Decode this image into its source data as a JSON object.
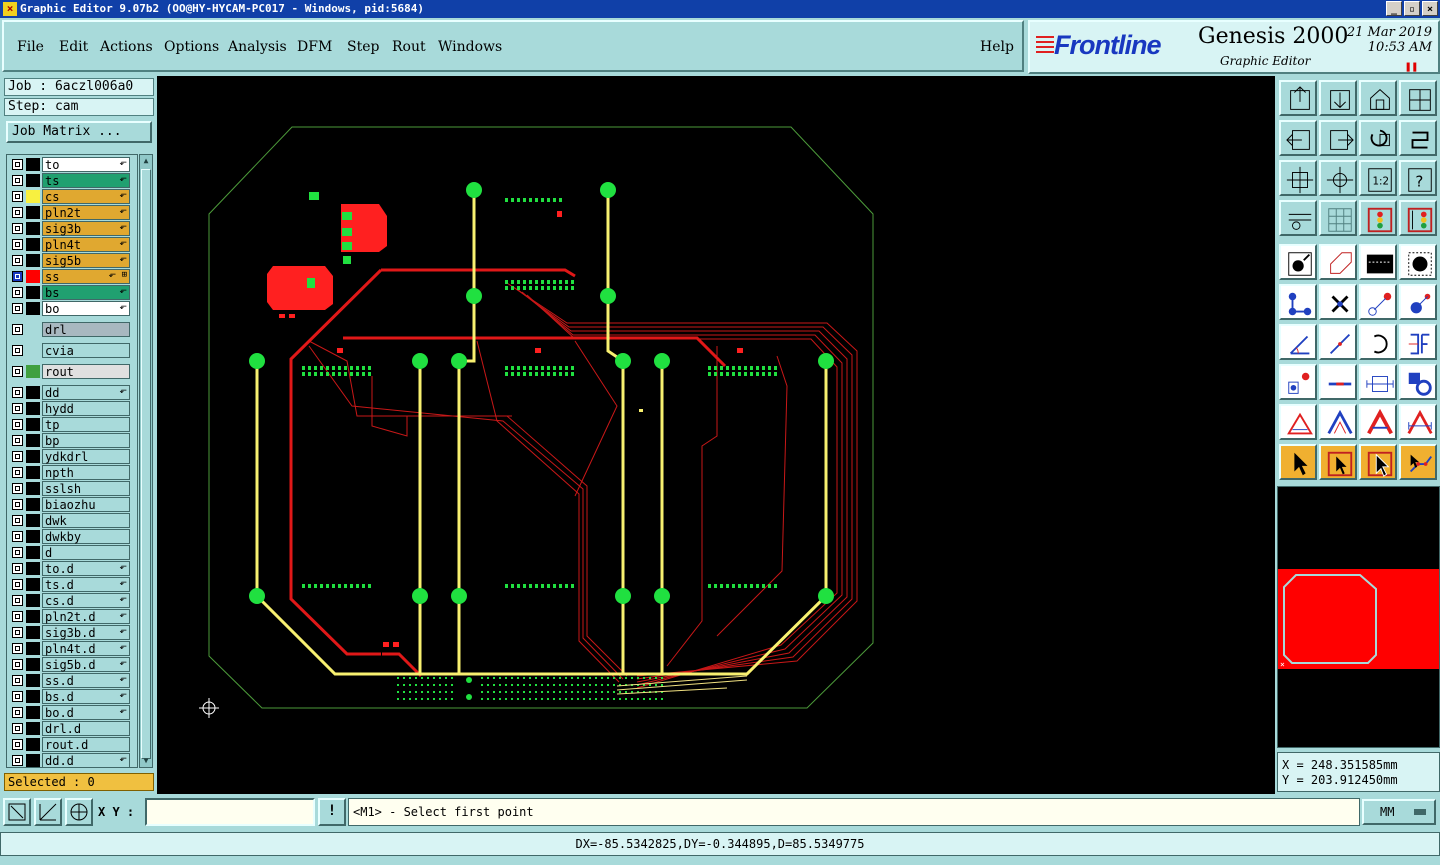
{
  "window": {
    "title": "Graphic Editor 9.07b2 (OO@HY-HYCAM-PC017 - Windows, pid:5684)",
    "controls": [
      "_",
      "▫",
      "×"
    ]
  },
  "menu": {
    "items": [
      "File",
      "Edit",
      "Actions",
      "Options",
      "Analysis",
      "DFM",
      "Step",
      "Rout",
      "Windows"
    ],
    "help": "Help"
  },
  "brand": {
    "logo_text": "Frontline",
    "product": "Genesis 2000",
    "subtitle": "Graphic Editor",
    "date": "21 Mar 2019",
    "time": "10:53 AM",
    "pause_icon": "pause-icon"
  },
  "job": {
    "job_line": "Job : 6aczl006a0",
    "step_line": "Step: cam",
    "matrix_button": "Job Matrix ..."
  },
  "layers": [
    {
      "name": "to",
      "bg": "#ffffff",
      "swatch": "#000000",
      "checked": false,
      "mark": "⬐"
    },
    {
      "name": "ts",
      "bg": "#20a070",
      "swatch": "#000000",
      "checked": false,
      "mark": "⬐"
    },
    {
      "name": "cs",
      "bg": "#e0a830",
      "swatch": "#f8f040",
      "checked": false,
      "mark": "⬐"
    },
    {
      "name": "pln2t",
      "bg": "#e0a830",
      "swatch": "#000000",
      "checked": false,
      "mark": "⬐"
    },
    {
      "name": "sig3b",
      "bg": "#e0a830",
      "swatch": "#000000",
      "checked": false,
      "mark": "⬐"
    },
    {
      "name": "pln4t",
      "bg": "#e0a830",
      "swatch": "#000000",
      "checked": false,
      "mark": "⬐"
    },
    {
      "name": "sig5b",
      "bg": "#e0a830",
      "swatch": "#000000",
      "checked": false,
      "mark": "⬐"
    },
    {
      "name": "ss",
      "bg": "#e0a830",
      "swatch": "#ff0000",
      "checked": true,
      "mark": "⬐ ⊞"
    },
    {
      "name": "bs",
      "bg": "#20a070",
      "swatch": "#000000",
      "checked": false,
      "mark": "⬐"
    },
    {
      "name": "bo",
      "bg": "#ffffff",
      "swatch": "#000000",
      "checked": false,
      "mark": "⬐"
    },
    {
      "name": "drl",
      "bg": "#a8b8c0",
      "swatch": "#a8dada",
      "checked": false,
      "mark": "",
      "gap": true
    },
    {
      "name": "cvia",
      "bg": "#a8dada",
      "swatch": "#a8dada",
      "checked": false,
      "mark": "",
      "gap": true
    },
    {
      "name": "rout",
      "bg": "#e0e0e0",
      "swatch": "#40a040",
      "checked": false,
      "mark": "",
      "gap": true
    },
    {
      "name": "dd",
      "bg": "#a8dada",
      "swatch": "#000000",
      "checked": false,
      "mark": "⬐",
      "gap": true
    },
    {
      "name": "hydd",
      "bg": "#a8dada",
      "swatch": "#000000",
      "checked": false,
      "mark": ""
    },
    {
      "name": "tp",
      "bg": "#a8dada",
      "swatch": "#000000",
      "checked": false,
      "mark": ""
    },
    {
      "name": "bp",
      "bg": "#a8dada",
      "swatch": "#000000",
      "checked": false,
      "mark": ""
    },
    {
      "name": "ydkdrl",
      "bg": "#a8dada",
      "swatch": "#000000",
      "checked": false,
      "mark": ""
    },
    {
      "name": "npth",
      "bg": "#a8dada",
      "swatch": "#000000",
      "checked": false,
      "mark": ""
    },
    {
      "name": "sslsh",
      "bg": "#a8dada",
      "swatch": "#000000",
      "checked": false,
      "mark": ""
    },
    {
      "name": "biaozhu",
      "bg": "#a8dada",
      "swatch": "#000000",
      "checked": false,
      "mark": ""
    },
    {
      "name": "dwk",
      "bg": "#a8dada",
      "swatch": "#000000",
      "checked": false,
      "mark": ""
    },
    {
      "name": "dwkby",
      "bg": "#a8dada",
      "swatch": "#000000",
      "checked": false,
      "mark": ""
    },
    {
      "name": "d",
      "bg": "#a8dada",
      "swatch": "#000000",
      "checked": false,
      "mark": ""
    },
    {
      "name": "to.d",
      "bg": "#a8dada",
      "swatch": "#000000",
      "checked": false,
      "mark": "⬐"
    },
    {
      "name": "ts.d",
      "bg": "#a8dada",
      "swatch": "#000000",
      "checked": false,
      "mark": "⬐"
    },
    {
      "name": "cs.d",
      "bg": "#a8dada",
      "swatch": "#000000",
      "checked": false,
      "mark": "⬐"
    },
    {
      "name": "pln2t.d",
      "bg": "#a8dada",
      "swatch": "#000000",
      "checked": false,
      "mark": "⬐"
    },
    {
      "name": "sig3b.d",
      "bg": "#a8dada",
      "swatch": "#000000",
      "checked": false,
      "mark": "⬐"
    },
    {
      "name": "pln4t.d",
      "bg": "#a8dada",
      "swatch": "#000000",
      "checked": false,
      "mark": "⬐"
    },
    {
      "name": "sig5b.d",
      "bg": "#a8dada",
      "swatch": "#000000",
      "checked": false,
      "mark": "⬐"
    },
    {
      "name": "ss.d",
      "bg": "#a8dada",
      "swatch": "#000000",
      "checked": false,
      "mark": "⬐"
    },
    {
      "name": "bs.d",
      "bg": "#a8dada",
      "swatch": "#000000",
      "checked": false,
      "mark": "⬐"
    },
    {
      "name": "bo.d",
      "bg": "#a8dada",
      "swatch": "#000000",
      "checked": false,
      "mark": "⬐"
    },
    {
      "name": "drl.d",
      "bg": "#a8dada",
      "swatch": "#000000",
      "checked": false,
      "mark": ""
    },
    {
      "name": "rout.d",
      "bg": "#a8dada",
      "swatch": "#000000",
      "checked": false,
      "mark": ""
    },
    {
      "name": "dd.d",
      "bg": "#a8dada",
      "swatch": "#000000",
      "checked": false,
      "mark": "⬐"
    }
  ],
  "selected_text": "Selected : 0",
  "toolbar_icons": [
    "zoom-home-icon",
    "zoom-fit-icon",
    "home-icon",
    "window-split-icon",
    "pan-left-icon",
    "pan-right-icon",
    "undo-zoom-icon",
    "redraw-icon",
    "zoom-extents-icon",
    "zoom-center-icon",
    "scale-1-2-icon",
    "help-query-icon",
    "measure-tool-icon",
    "grid-icon",
    "layer-panel-icon",
    "layer-panel-alt-icon",
    "add-feature-icon",
    "polygon-icon",
    "ruler-icon",
    "pad-icon",
    "snap-nodes-icon",
    "cross-snap-icon",
    "line-snap-icon",
    "point-snap-icon",
    "angle-icon",
    "line-draw-icon",
    "arc-icon",
    "text-edit-icon",
    "move-icon",
    "resize-icon",
    "dimension-icon",
    "copy-icon",
    "drc-triangle-icon",
    "triangle-outline-icon",
    "triangle-fill-icon",
    "triangle-measure-icon",
    "select-arrow-icon",
    "select-box-icon",
    "select-highlight-icon",
    "select-net-icon"
  ],
  "coords": {
    "x": "X = 248.351585mm",
    "y": "Y = 203.912450mm"
  },
  "bottom": {
    "xy_label": "X Y :",
    "xy_value": "",
    "excl_label": "!",
    "prompt": "<M1> - Select first point",
    "units": "MM",
    "status": "DX=-85.5342825,DY=-0.344895,D=85.5349775"
  },
  "colors": {
    "board_outline": "#4c9a3a",
    "trace_red": "#e01818",
    "trace_yellow": "#f8f070",
    "pad_green": "#20e040",
    "pad_red": "#ff2020",
    "minimap_red": "#ff0000"
  }
}
